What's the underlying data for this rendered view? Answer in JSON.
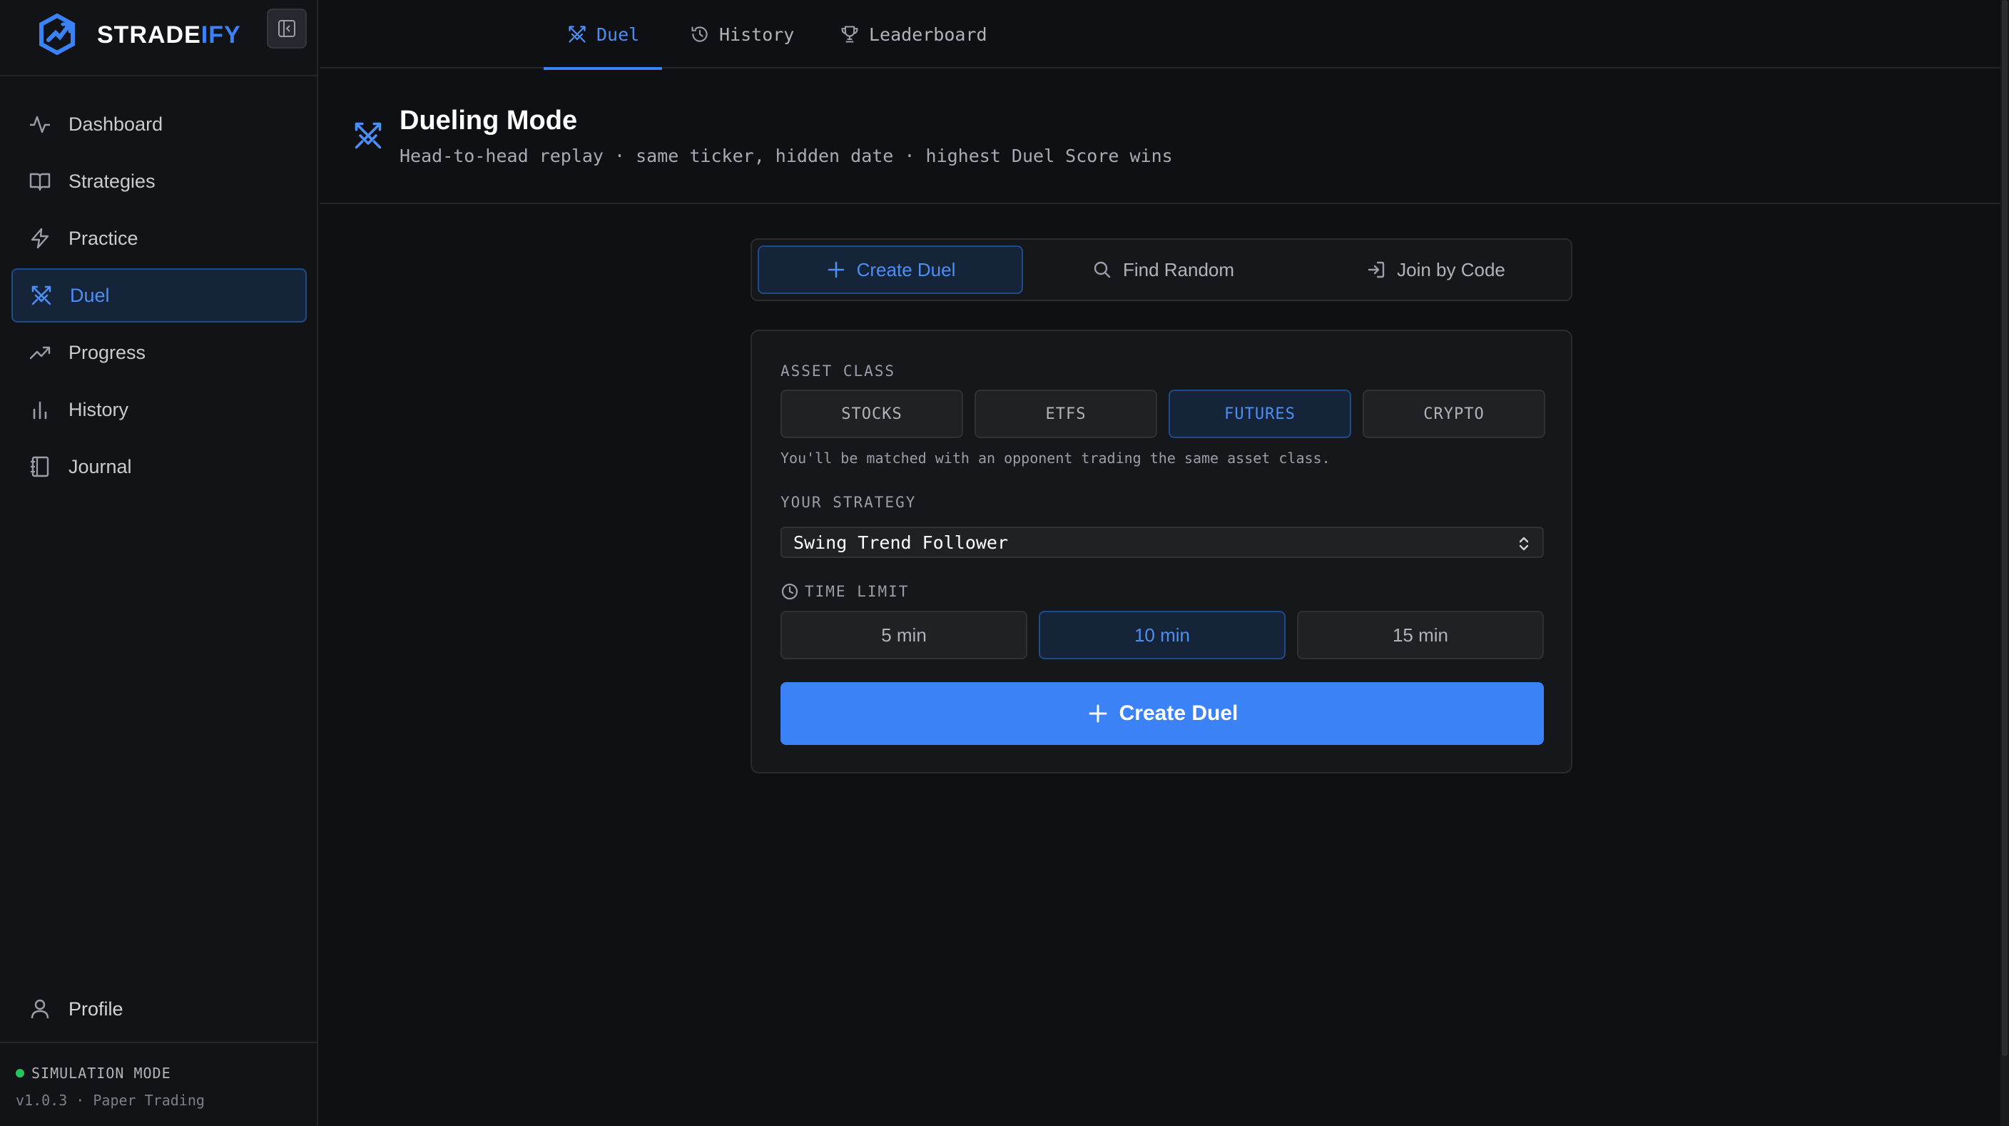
{
  "brand": {
    "name_main": "STRADE",
    "name_accent": "IFY"
  },
  "sidebar": {
    "items": [
      {
        "label": "Dashboard",
        "icon": "activity-icon"
      },
      {
        "label": "Strategies",
        "icon": "book-icon"
      },
      {
        "label": "Practice",
        "icon": "lightning-icon"
      },
      {
        "label": "Duel",
        "icon": "crossed-swords-icon",
        "active": true
      },
      {
        "label": "Progress",
        "icon": "trending-up-icon"
      },
      {
        "label": "History",
        "icon": "bar-chart-icon"
      },
      {
        "label": "Journal",
        "icon": "notebook-icon"
      }
    ],
    "profile": "Profile",
    "footer": {
      "mode": "SIMULATION MODE",
      "version": "v1.0.3 · Paper Trading"
    }
  },
  "tabs": [
    {
      "label": "Duel",
      "icon": "crossed-swords-icon",
      "active": true
    },
    {
      "label": "History",
      "icon": "history-icon"
    },
    {
      "label": "Leaderboard",
      "icon": "trophy-icon"
    }
  ],
  "header": {
    "title": "Dueling Mode",
    "subtitle": "Head-to-head replay · same ticker, hidden date · highest Duel Score wins"
  },
  "mode_switch": [
    {
      "label": "Create Duel",
      "icon": "plus-icon",
      "active": true
    },
    {
      "label": "Find Random",
      "icon": "search-icon"
    },
    {
      "label": "Join by Code",
      "icon": "login-icon"
    }
  ],
  "form": {
    "asset_class_label": "ASSET CLASS",
    "asset_classes": [
      {
        "label": "STOCKS"
      },
      {
        "label": "ETFS"
      },
      {
        "label": "FUTURES",
        "active": true
      },
      {
        "label": "CRYPTO"
      }
    ],
    "asset_hint": "You'll be matched with an opponent trading the same asset class.",
    "strategy_label": "YOUR STRATEGY",
    "strategy_value": "Swing Trend Follower",
    "time_limit_label": "TIME LIMIT",
    "time_limits": [
      {
        "label": "5 min"
      },
      {
        "label": "10 min",
        "active": true
      },
      {
        "label": "15 min"
      }
    ],
    "submit_label": "Create Duel"
  },
  "colors": {
    "accent": "#3b82f6",
    "status_ok": "#22c55e",
    "background": "#0f1013"
  }
}
